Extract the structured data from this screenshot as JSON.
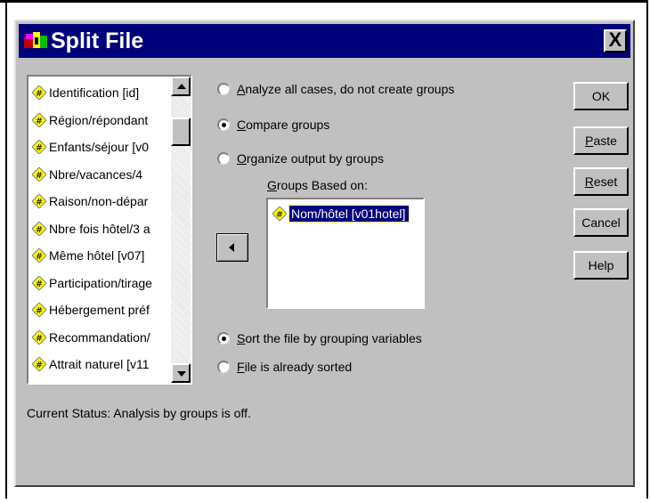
{
  "window": {
    "title": "Split File",
    "close_glyph": "X",
    "app_icon": "spss-app-icon"
  },
  "variables": {
    "items": [
      "Identification [id]",
      "Région/répondant",
      "Enfants/séjour [v0",
      "Nbre/vacances/4",
      "Raison/non-dépar",
      "Nbre fois hôtel/3 a",
      "Même hôtel [v07]",
      "Participation/tirage",
      "Hébergement préf",
      "Recommandation/",
      "Attrait naturel [v11"
    ],
    "icon": "nominal-variable-icon"
  },
  "grouping_options": {
    "analyze_all": "Analyze all cases, do not create groups",
    "analyze_all_key": "A",
    "analyze_all_rest": "nalyze all cases, do not create groups",
    "compare": "Compare groups",
    "compare_key": "C",
    "compare_rest": "ompare groups",
    "organize": "Organize output by groups",
    "organize_key": "O",
    "organize_rest": "rganize output by groups",
    "selected": "compare"
  },
  "groups_based_on": {
    "label_key": "G",
    "label_rest": "roups Based on:",
    "items": [
      "Nom/hôtel [v01hotel]"
    ]
  },
  "sort_options": {
    "sort_key": "S",
    "sort_rest": "ort the file by grouping variables",
    "sorted_key": "F",
    "sorted_rest": "ile is already sorted",
    "selected": "sort"
  },
  "buttons": {
    "ok": "OK",
    "paste_key": "P",
    "paste_rest": "aste",
    "reset_key": "R",
    "reset_rest": "eset",
    "cancel": "Cancel",
    "help": "Help"
  },
  "status": "Current Status:  Analysis by groups is off.",
  "colors": {
    "titlebar": "#00007b",
    "dialog": "#c0c0c0",
    "selection": "#00007b"
  }
}
